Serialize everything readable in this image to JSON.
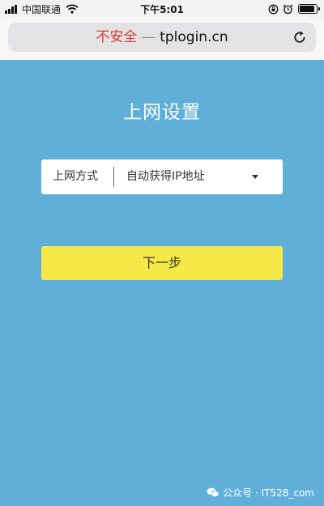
{
  "status_bar": {
    "carrier": "中国联通",
    "time": "下午5:01",
    "icons": [
      "signal-icon",
      "wifi-icon",
      "orientation-lock-icon",
      "alarm-icon",
      "battery-icon"
    ]
  },
  "browser": {
    "security_label": "不安全",
    "separator": " — ",
    "url": "tplogin.cn",
    "reload_icon": "reload-icon"
  },
  "page": {
    "title": "上网设置",
    "connection_type": {
      "label": "上网方式",
      "selected": "自动获得IP地址",
      "dropdown_icon": "caret-down-icon"
    },
    "next_label": "下一步"
  },
  "watermark": {
    "text": "公众号 · IT528_com",
    "icon": "wechat-logo-icon"
  },
  "colors": {
    "page_background": "#5fafd9",
    "button_background": "#f6e846",
    "insecure_red": "#e0362b"
  }
}
